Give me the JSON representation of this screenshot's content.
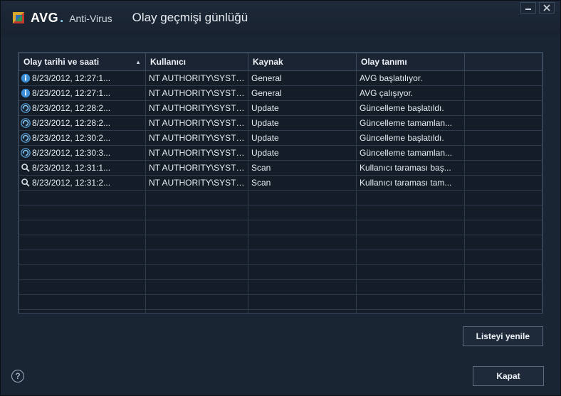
{
  "app": {
    "brand": "AVG",
    "product": "Anti-Virus",
    "window_title": "Olay geçmişi günlüğü"
  },
  "columns": {
    "datetime": "Olay tarihi ve saati",
    "user": "Kullanıcı",
    "source": "Kaynak",
    "description": "Olay tanımı",
    "extra": ""
  },
  "rows": [
    {
      "icon": "info",
      "datetime": "8/23/2012, 12:27:1...",
      "user": "NT AUTHORITY\\SYSTEM",
      "source": "General",
      "description": "AVG başlatılıyor."
    },
    {
      "icon": "info",
      "datetime": "8/23/2012, 12:27:1...",
      "user": "NT AUTHORITY\\SYSTEM",
      "source": "General",
      "description": "AVG çalışıyor."
    },
    {
      "icon": "update",
      "datetime": "8/23/2012, 12:28:2...",
      "user": "NT AUTHORITY\\SYSTEM",
      "source": "Update",
      "description": "Güncelleme başlatıldı."
    },
    {
      "icon": "update",
      "datetime": "8/23/2012, 12:28:2...",
      "user": "NT AUTHORITY\\SYSTEM",
      "source": "Update",
      "description": "Güncelleme tamamlan..."
    },
    {
      "icon": "update",
      "datetime": "8/23/2012, 12:30:2...",
      "user": "NT AUTHORITY\\SYSTEM",
      "source": "Update",
      "description": "Güncelleme başlatıldı."
    },
    {
      "icon": "update",
      "datetime": "8/23/2012, 12:30:3...",
      "user": "NT AUTHORITY\\SYSTEM",
      "source": "Update",
      "description": "Güncelleme tamamlan..."
    },
    {
      "icon": "scan",
      "datetime": "8/23/2012, 12:31:1...",
      "user": "NT AUTHORITY\\SYSTEM",
      "source": "Scan",
      "description": "Kullanıcı taraması baş..."
    },
    {
      "icon": "scan",
      "datetime": "8/23/2012, 12:31:2...",
      "user": "NT AUTHORITY\\SYSTEM",
      "source": "Scan",
      "description": "Kullanıcı taraması tam..."
    }
  ],
  "empty_row_count": 9,
  "buttons": {
    "refresh": "Listeyi yenile",
    "close": "Kapat"
  }
}
